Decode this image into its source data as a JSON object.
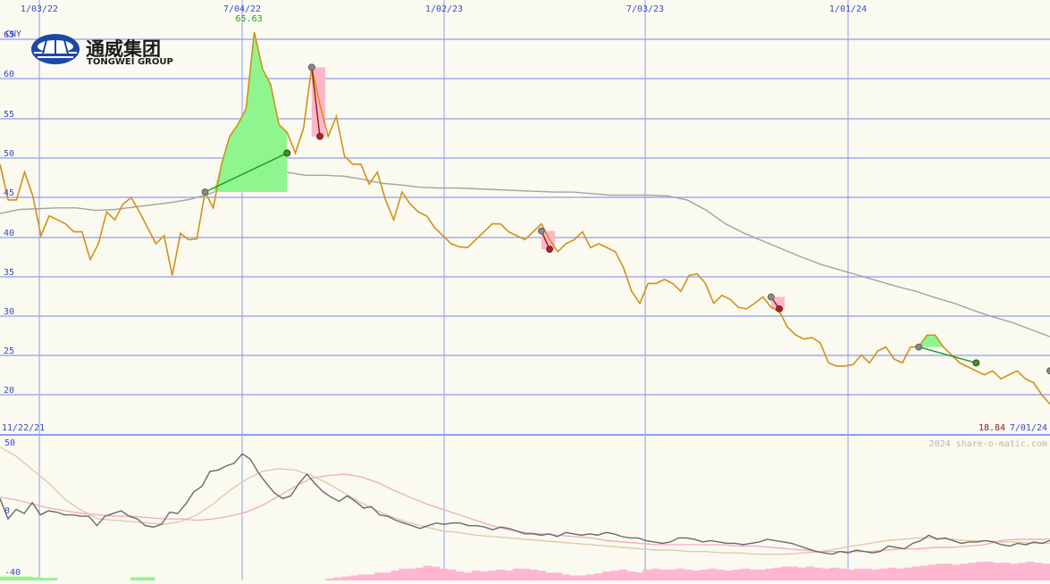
{
  "logo": {
    "chinese": "通威集团",
    "english": "TONGWEI GROUP"
  },
  "watermark": "2024 share-o-matic.com",
  "colors": {
    "background": "#fafaf0",
    "grid": "#8f9cf0",
    "price_line": "#d4901a",
    "ma_line": "#a3a3a3",
    "gain_fill": "#8ff58f",
    "loss_fill": "#ffb6c8",
    "gain_line": "#1f9a1f",
    "loss_line": "#8b1a1a",
    "osc_line": "#6a6a6a",
    "osc_pink": "#f3a8c3",
    "osc_tan": "#e0c7a5",
    "volume_pink": "#ffb6cf",
    "volume_green": "#8ff58f",
    "peak_label": "#1f9a1f",
    "last_price_label": "#8b1a1a",
    "axis_text": "#3a4acb"
  },
  "chart_data": [
    {
      "type": "line",
      "currency_label": "CNY",
      "ylim": [
        18,
        65
      ],
      "y_ticks": [
        20,
        25,
        30,
        35,
        40,
        45,
        50,
        55,
        60,
        65
      ],
      "x_tick_labels": [
        "1/03/22",
        "7/04/22",
        "1/02/23",
        "7/03/23",
        "1/01/24"
      ],
      "start_date_label": "11/22/21",
      "end_date_label": "7/01/24",
      "peak_label": "65.63",
      "last_price_label": "18.84",
      "series": [
        {
          "values": [
            49,
            44.5,
            44.5,
            48,
            45,
            40,
            42.5,
            42,
            41.5,
            40.5,
            40.5,
            37,
            39,
            43,
            42,
            44,
            44.8,
            43,
            41,
            39,
            40,
            35,
            40.3,
            39.5,
            39.6,
            45.5,
            43.5,
            49,
            52.5,
            54,
            56,
            65.6,
            61,
            59,
            54,
            53,
            50.4,
            53.5,
            61.2,
            56.5,
            52.5,
            55,
            50,
            49,
            49,
            46.5,
            48,
            44.5,
            42,
            45.5,
            44,
            43,
            42.5,
            41,
            40,
            39,
            38.6,
            38.5,
            39.5,
            40.5,
            41.5,
            41.5,
            40.5,
            40,
            39.5,
            40.5,
            41.5,
            39.5,
            38,
            39,
            39.5,
            40.5,
            38.5,
            39,
            38.5,
            38,
            36,
            33,
            31.5,
            34,
            34,
            34.5,
            34,
            33,
            35,
            35.2,
            34,
            31.5,
            32.5,
            32,
            31,
            30.8,
            31.5,
            32.3,
            31,
            30.5,
            28.5,
            27.5,
            27,
            27.2,
            26.5,
            24,
            23.6,
            23.6,
            23.8,
            25,
            24,
            25.5,
            26,
            24.5,
            24,
            26,
            26,
            27.5,
            27.5,
            26,
            25,
            24,
            23.5,
            23,
            22.5,
            23,
            22,
            22.5,
            23,
            22,
            21.5,
            20,
            18.8
          ]
        },
        {
          "values": [
            42.8,
            43.3,
            43.4,
            43.5,
            43.5,
            43.2,
            43.3,
            43.6,
            43.9,
            44.2,
            44.6,
            45.3,
            46.3,
            47.2,
            47.7,
            48,
            47.6,
            47.6,
            47.5,
            47.1,
            46.6,
            46.4,
            46.1,
            46,
            46,
            45.9,
            45.8,
            45.7,
            45.6,
            45.5,
            45.5,
            45.3,
            45.1,
            45.1,
            45.1,
            45,
            44.5,
            43.2,
            41.5,
            40.3,
            39.3,
            38.3,
            37.3,
            36.4,
            35.7,
            35,
            34.3,
            33.6,
            33,
            32.2,
            31.5,
            30.6,
            29.8,
            29.1,
            28.2,
            27.3
          ]
        }
      ],
      "trade_markers": [
        {
          "from": [
            25,
            45.5
          ],
          "to": [
            35,
            50.4
          ],
          "result": "gain"
        },
        {
          "from": [
            38,
            61.2
          ],
          "to": [
            39,
            52.5
          ],
          "result": "loss"
        },
        {
          "from": [
            66,
            40.6
          ],
          "to": [
            67,
            38.3
          ],
          "result": "loss"
        },
        {
          "from": [
            94,
            32.3
          ],
          "to": [
            95,
            30.8
          ],
          "result": "loss"
        },
        {
          "from": [
            112,
            26
          ],
          "to": [
            119,
            24
          ],
          "result": "gain"
        },
        {
          "from": [
            128,
            23
          ],
          "to": [
            129,
            21.8
          ],
          "result": "loss"
        }
      ]
    },
    {
      "type": "line",
      "ylim": [
        -40,
        50
      ],
      "y_ticks": [
        50,
        0,
        -40
      ],
      "series": [
        {
          "values": [
            9,
            -6,
            1,
            -2,
            6,
            -3,
            0,
            -1,
            -3,
            -3,
            -4,
            -4,
            -11,
            -4,
            -2,
            0,
            -4,
            -6,
            -11,
            -12,
            -10,
            -1,
            -2,
            5,
            14,
            18,
            29,
            30,
            33,
            35,
            42,
            38,
            28,
            20,
            13,
            9,
            11,
            20,
            27,
            20,
            14,
            10,
            7,
            11,
            7,
            2,
            3,
            -3,
            -4,
            -7,
            -9,
            -11,
            -13,
            -11,
            -9,
            -10,
            -9,
            -9,
            -11,
            -11,
            -12,
            -14,
            -12,
            -13,
            -15,
            -17,
            -17,
            -18,
            -17,
            -19,
            -16,
            -17,
            -18,
            -17,
            -18,
            -16,
            -17,
            -19,
            -20,
            -20,
            -22,
            -23,
            -24,
            -23,
            -20,
            -20,
            -21,
            -23,
            -22,
            -23,
            -24,
            -24,
            -25,
            -24,
            -23,
            -21,
            -22,
            -23,
            -24,
            -26,
            -28,
            -30,
            -31,
            -32,
            -30,
            -31,
            -29,
            -30,
            -31,
            -30,
            -26,
            -27,
            -28,
            -24,
            -22,
            -18,
            -21,
            -20,
            -22,
            -24,
            -23,
            -23,
            -22,
            -23,
            -25,
            -26,
            -24,
            -25,
            -23,
            -24,
            -22
          ]
        },
        {
          "values": [
            10,
            8,
            5,
            2,
            0,
            -2,
            -3,
            -4,
            -4,
            -5,
            -6,
            -6,
            -7,
            -6,
            -4,
            -1,
            4,
            11,
            18,
            24,
            26,
            27,
            25,
            21,
            15,
            10,
            5,
            1,
            -3,
            -7,
            -11,
            -14,
            -16,
            -17,
            -18,
            -19,
            -20,
            -22,
            -23,
            -24,
            -25,
            -25,
            -25,
            -25,
            -25,
            -26,
            -26,
            -27,
            -28,
            -29,
            -30,
            -30,
            -30,
            -30,
            -29,
            -28,
            -28,
            -27,
            -27,
            -26,
            -25,
            -22,
            -21,
            -21,
            -21
          ]
        },
        {
          "values": [
            47,
            40,
            30,
            20,
            8,
            0,
            -6,
            -7,
            -8,
            -9,
            -10,
            -8,
            -3,
            5,
            15,
            23,
            29,
            31,
            30,
            26,
            20,
            13,
            6,
            0,
            -5,
            -9,
            -12,
            -15,
            -16,
            -18,
            -19,
            -20,
            -21,
            -22,
            -23,
            -24,
            -25,
            -26,
            -27,
            -28,
            -29,
            -29,
            -30,
            -30,
            -31,
            -31,
            -32,
            -32,
            -32,
            -31,
            -30,
            -28,
            -26,
            -24,
            -22,
            -21,
            -20,
            -20,
            -21,
            -22,
            -22,
            -23,
            -23,
            -24,
            -24
          ]
        }
      ],
      "volume_bars": {
        "pink": [
          0,
          0,
          0,
          0,
          0,
          0,
          0,
          0,
          0,
          0,
          0,
          0,
          0,
          0,
          0,
          0,
          0,
          0,
          0,
          0,
          0,
          0,
          0,
          0,
          0,
          0,
          0,
          0,
          0,
          0,
          0,
          0,
          0,
          0,
          0,
          0,
          0,
          0,
          0,
          0,
          0.1,
          0.15,
          0.2,
          0.25,
          0.3,
          0.3,
          0.4,
          0.4,
          0.5,
          0.6,
          0.6,
          0.65,
          0.75,
          0.7,
          0.6,
          0.55,
          0.45,
          0.4,
          0.5,
          0.45,
          0.5,
          0.55,
          0.5,
          0.6,
          0.6,
          0.55,
          0.5,
          0.4,
          0.4,
          0.3,
          0.25,
          0.25,
          0.3,
          0.35,
          0.45,
          0.5,
          0.55,
          0.45,
          0.4,
          0.55,
          0.6,
          0.55,
          0.55,
          0.6,
          0.55,
          0.5,
          0.55,
          0.6,
          0.55,
          0.5,
          0.55,
          0.6,
          0.55,
          0.55,
          0.6,
          0.65,
          0.7,
          0.7,
          0.65,
          0.7,
          0.65,
          0.6,
          0.65,
          0.6,
          0.55,
          0.6,
          0.6,
          0.55,
          0.6,
          0.65,
          0.6,
          0.65,
          0.7,
          0.75,
          0.8,
          0.85,
          0.85,
          0.8,
          0.85,
          0.9,
          0.95,
          0.95,
          0.9,
          0.9,
          0.85,
          0.9,
          0.95,
          0.9,
          0.85
        ],
        "green": [
          0.3,
          0.3,
          0.3,
          0.3,
          0.25,
          0.2,
          0.2,
          0,
          0,
          0,
          0,
          0,
          0,
          0,
          0,
          0,
          0.25,
          0.25,
          0.25,
          0,
          0,
          0,
          0,
          0,
          0,
          0,
          0,
          0,
          0,
          0,
          0,
          0,
          0,
          0,
          0,
          0,
          0,
          0,
          0,
          0
        ]
      }
    }
  ]
}
